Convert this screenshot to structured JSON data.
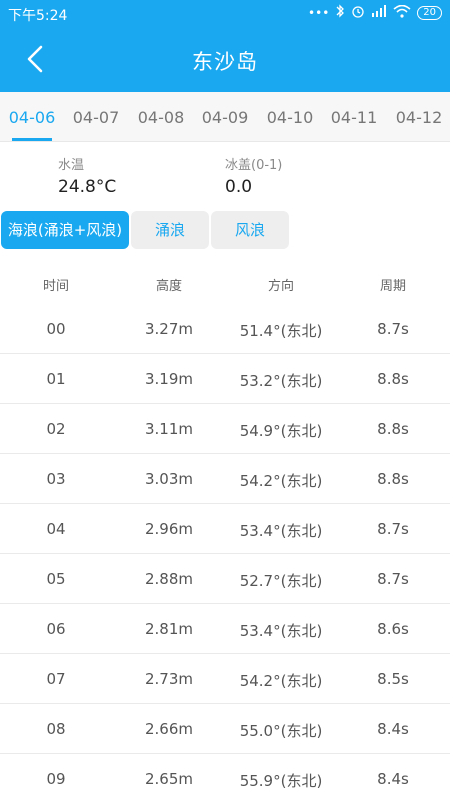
{
  "status_bar": {
    "time": "下午5:24",
    "battery": "20"
  },
  "header": {
    "title": "东沙岛"
  },
  "date_tabs": [
    "04-06",
    "04-07",
    "04-08",
    "04-09",
    "04-10",
    "04-11",
    "04-12"
  ],
  "active_date_index": 0,
  "info": {
    "water_temp_label": "水温",
    "water_temp_value": "24.8°C",
    "ice_label": "冰盖(0-1)",
    "ice_value": "0.0"
  },
  "wave_tabs": [
    "海浪(涌浪+风浪)",
    "涌浪",
    "风浪"
  ],
  "active_wave_index": 0,
  "table": {
    "headers": [
      "时间",
      "高度",
      "方向",
      "周期"
    ],
    "rows": [
      [
        "00",
        "3.27m",
        "51.4°(东北)",
        "8.7s"
      ],
      [
        "01",
        "3.19m",
        "53.2°(东北)",
        "8.8s"
      ],
      [
        "02",
        "3.11m",
        "54.9°(东北)",
        "8.8s"
      ],
      [
        "03",
        "3.03m",
        "54.2°(东北)",
        "8.8s"
      ],
      [
        "04",
        "2.96m",
        "53.4°(东北)",
        "8.7s"
      ],
      [
        "05",
        "2.88m",
        "52.7°(东北)",
        "8.7s"
      ],
      [
        "06",
        "2.81m",
        "53.4°(东北)",
        "8.6s"
      ],
      [
        "07",
        "2.73m",
        "54.2°(东北)",
        "8.5s"
      ],
      [
        "08",
        "2.66m",
        "55.0°(东北)",
        "8.4s"
      ],
      [
        "09",
        "2.65m",
        "55.9°(东北)",
        "8.4s"
      ]
    ]
  },
  "icons": {
    "back": "chevron-left-icon",
    "signal": "signal-icon",
    "wifi": "wifi-icon",
    "bluetooth": "bluetooth-icon",
    "battery": "battery-icon"
  },
  "colors": {
    "accent": "#1aa8f0",
    "tab_background": "#eeeeee",
    "date_bar_background": "#f7f7f7"
  }
}
